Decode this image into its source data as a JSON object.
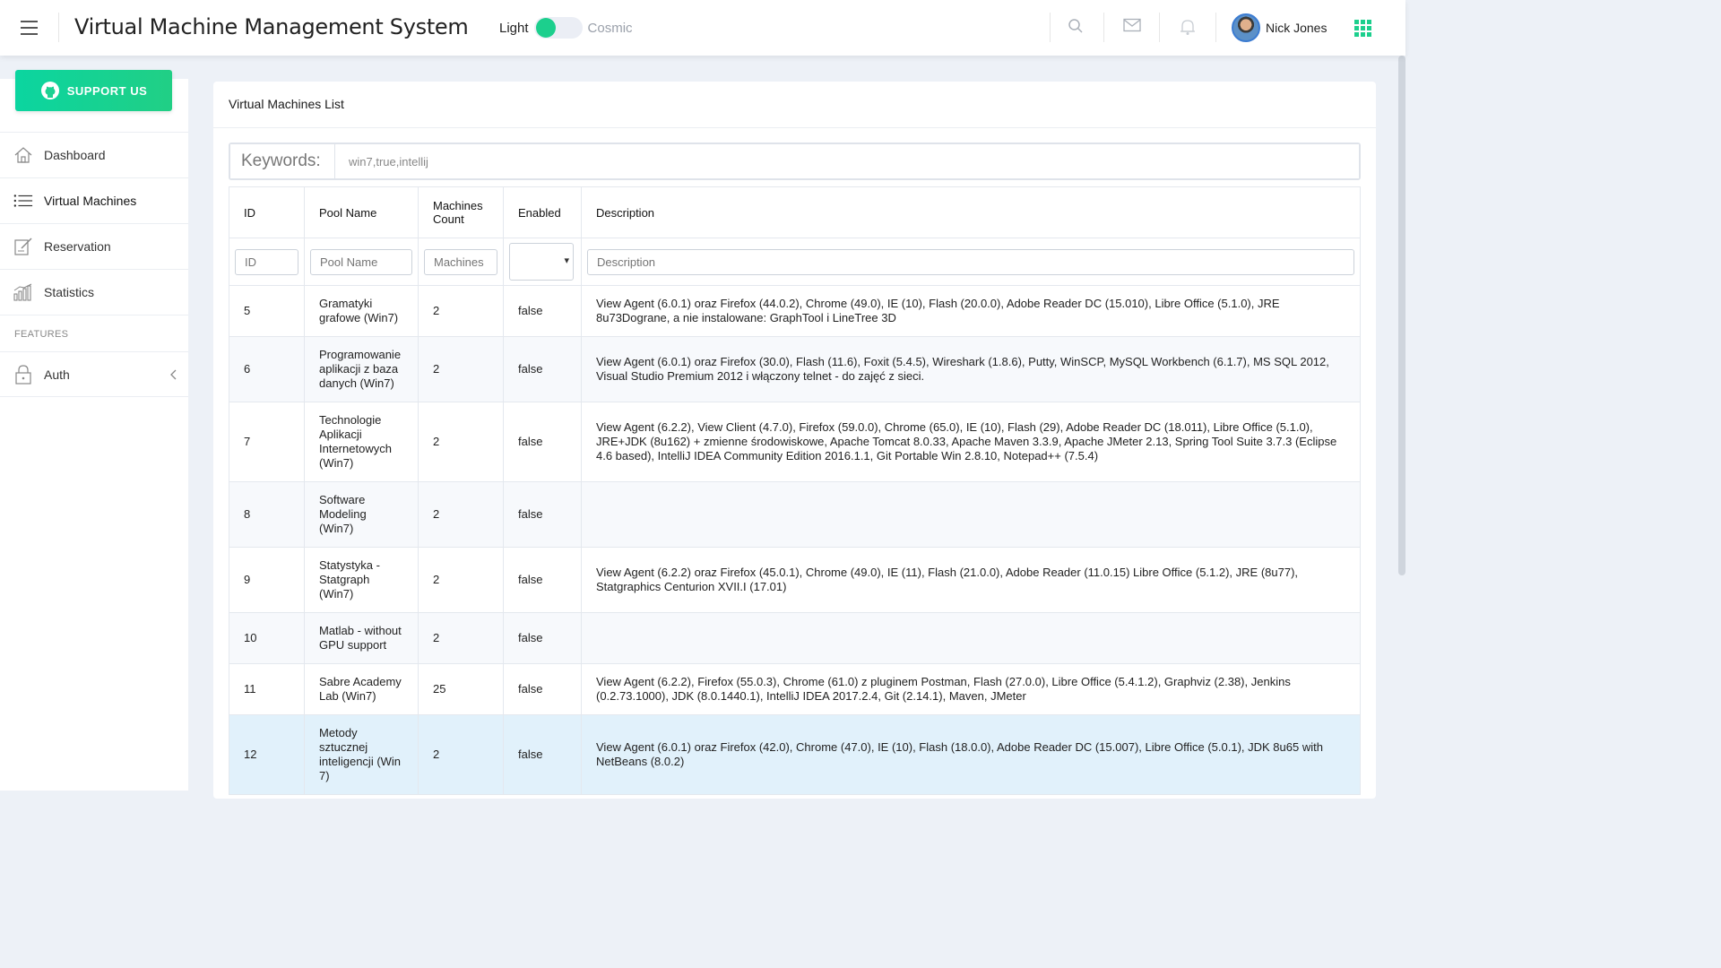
{
  "header": {
    "title": "Virtual Machine Management System",
    "theme_light": "Light",
    "theme_cosmic": "Cosmic",
    "user_name": "Nick Jones"
  },
  "sidebar": {
    "support_label": "SUPPORT US",
    "items": [
      {
        "label": "Dashboard",
        "icon": "home-icon"
      },
      {
        "label": "Virtual Machines",
        "icon": "list-icon"
      },
      {
        "label": "Reservation",
        "icon": "edit-icon"
      },
      {
        "label": "Statistics",
        "icon": "bar-chart-icon"
      }
    ],
    "group_label": "FEATURES",
    "auth_label": "Auth"
  },
  "main": {
    "card_title": "Virtual Machines List",
    "keywords_label": "Keywords:",
    "keywords_value": "win7,true,intellij",
    "columns": [
      "ID",
      "Pool Name",
      "Machines Count",
      "Enabled",
      "Description"
    ],
    "filters": {
      "id_placeholder": "ID",
      "pool_placeholder": "Pool Name",
      "machines_placeholder": "Machines",
      "description_placeholder": "Description"
    },
    "rows": [
      {
        "id": "5",
        "pool": "Gramatyki grafowe (Win7)",
        "count": "2",
        "enabled": "false",
        "desc": "View Agent (6.0.1) oraz Firefox (44.0.2), Chrome (49.0), IE (10), Flash (20.0.0), Adobe Reader DC (15.010), Libre Office (5.1.0), JRE 8u73Dograne, a nie instalowane: GraphTool i LineTree 3D"
      },
      {
        "id": "6",
        "pool": "Programowanie aplikacji z baza danych (Win7)",
        "count": "2",
        "enabled": "false",
        "desc": "View Agent (6.0.1) oraz Firefox (30.0), Flash (11.6), Foxit (5.4.5), Wireshark (1.8.6), Putty, WinSCP, MySQL Workbench (6.1.7), MS SQL 2012, Visual Studio Premium 2012 i włączony telnet - do zajęć z sieci."
      },
      {
        "id": "7",
        "pool": "Technologie Aplikacji Internetowych (Win7)",
        "count": "2",
        "enabled": "false",
        "desc": "View Agent (6.2.2), View Client (4.7.0), Firefox (59.0.0), Chrome (65.0), IE (10), Flash (29), Adobe Reader DC (18.011), Libre Office (5.1.0), JRE+JDK (8u162) + zmienne środowiskowe, Apache Tomcat 8.0.33, Apache Maven 3.3.9, Apache JMeter 2.13, Spring Tool Suite 3.7.3 (Eclipse 4.6 based), IntelliJ IDEA Community Edition 2016.1.1, Git Portable Win 2.8.10, Notepad++ (7.5.4)"
      },
      {
        "id": "8",
        "pool": "Software Modeling (Win7)",
        "count": "2",
        "enabled": "false",
        "desc": ""
      },
      {
        "id": "9",
        "pool": "Statystyka - Statgraph (Win7)",
        "count": "2",
        "enabled": "false",
        "desc": "View Agent (6.2.2) oraz Firefox (45.0.1), Chrome (49.0), IE (11), Flash (21.0.0), Adobe Reader (11.0.15) Libre Office (5.1.2), JRE (8u77), Statgraphics Centurion XVII.I (17.01)"
      },
      {
        "id": "10",
        "pool": "Matlab - without GPU support",
        "count": "2",
        "enabled": "false",
        "desc": ""
      },
      {
        "id": "11",
        "pool": "Sabre Academy Lab (Win7)",
        "count": "25",
        "enabled": "false",
        "desc": "View Agent (6.2.2), Firefox (55.0.3), Chrome (61.0) z pluginem Postman, Flash (27.0.0), Libre Office (5.4.1.2), Graphviz (2.38), Jenkins (0.2.73.1000), JDK (8.0.1440.1), IntelliJ IDEA 2017.2.4, Git (2.14.1), Maven, JMeter"
      },
      {
        "id": "12",
        "pool": "Metody sztucznej inteligencji (Win 7)",
        "count": "2",
        "enabled": "false",
        "desc": "View Agent (6.0.1) oraz Firefox (42.0), Chrome (47.0), IE (10), Flash (18.0.0), Adobe Reader DC (15.007), Libre Office (5.0.1), JDK 8u65 with NetBeans (8.0.2)"
      }
    ]
  },
  "colors": {
    "accent": "#1ccf8d",
    "selected_row": "#e1f1fb"
  }
}
